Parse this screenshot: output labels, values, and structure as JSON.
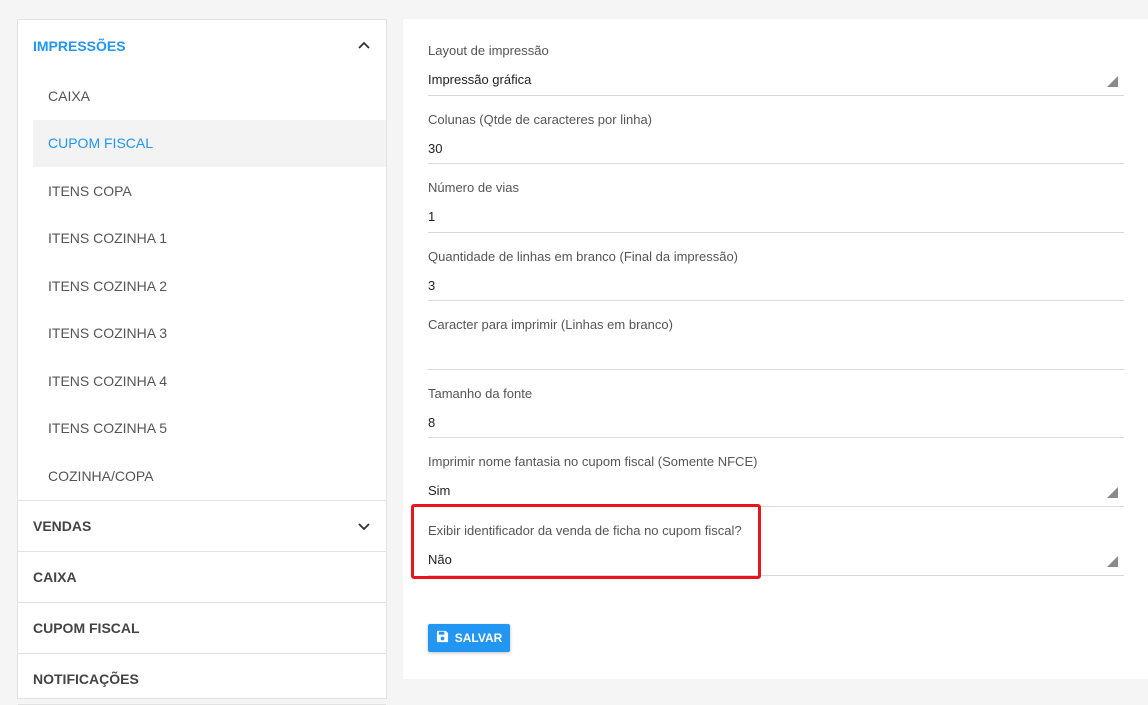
{
  "sidebar": {
    "sections": [
      {
        "title": "IMPRESSÕES",
        "open": true,
        "items": [
          "CAIXA",
          "CUPOM FISCAL",
          "ITENS COPA",
          "ITENS COZINHA 1",
          "ITENS COZINHA 2",
          "ITENS COZINHA 3",
          "ITENS COZINHA 4",
          "ITENS COZINHA 5",
          "COZINHA/COPA"
        ],
        "active_item": "CUPOM FISCAL"
      },
      {
        "title": "VENDAS",
        "open": false,
        "chevron": true
      },
      {
        "title": "CAIXA",
        "open": false
      },
      {
        "title": "CUPOM FISCAL",
        "open": false
      },
      {
        "title": "NOTIFICAÇÕES",
        "open": false
      }
    ]
  },
  "form": {
    "fields": [
      {
        "label": "Layout de impressão",
        "value": "Impressão gráfica",
        "type": "select"
      },
      {
        "label": "Colunas (Qtde de caracteres por linha)",
        "value": "30",
        "type": "input"
      },
      {
        "label": "Número de vias",
        "value": "1",
        "type": "input"
      },
      {
        "label": "Quantidade de linhas em branco (Final da impressão)",
        "value": "3",
        "type": "input"
      },
      {
        "label": "Caracter para imprimir (Linhas em branco)",
        "value": "",
        "type": "input"
      },
      {
        "label": "Tamanho da fonte",
        "value": "8",
        "type": "input"
      },
      {
        "label": "Imprimir nome fantasia no cupom fiscal (Somente NFCE)",
        "value": "Sim",
        "type": "select"
      },
      {
        "label": "Exibir identificador da venda de ficha no cupom fiscal?",
        "value": "Não",
        "type": "select"
      }
    ],
    "save_label": "SALVAR",
    "save_icon": "floppy-disk-icon"
  },
  "colors": {
    "accent": "#2196f3",
    "highlight": "#e8161c"
  }
}
